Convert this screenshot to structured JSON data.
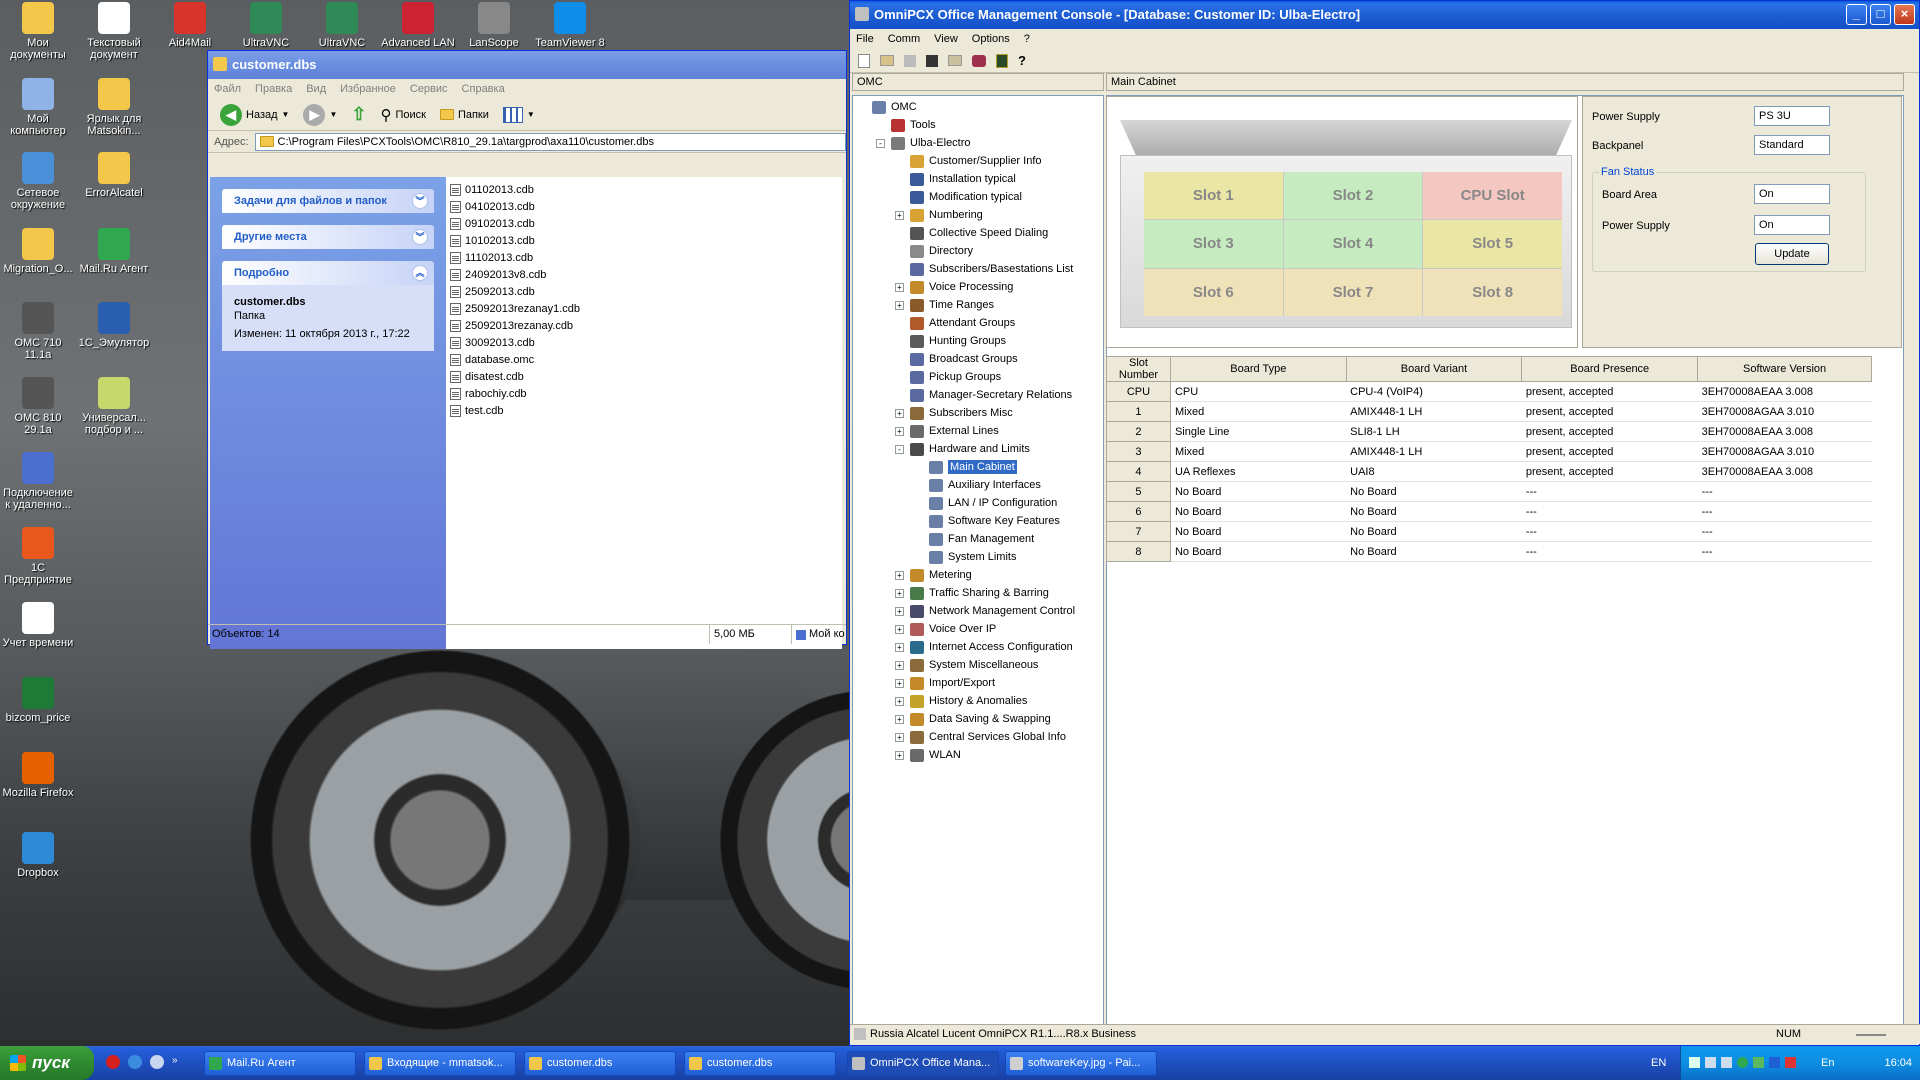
{
  "desktop": {
    "icons": [
      {
        "label": "Мои документы",
        "color": "#f3c74a"
      },
      {
        "label": "Текстовый документ",
        "color": "#ffffff"
      },
      {
        "label": "Aid4Mail",
        "color": "#d9342b"
      },
      {
        "label": "UltraVNC",
        "color": "#2e8b57"
      },
      {
        "label": "UltraVNC",
        "color": "#2e8b57"
      },
      {
        "label": "Advanced LAN",
        "color": "#cc2233"
      },
      {
        "label": "LanScope",
        "color": "#888888"
      },
      {
        "label": "TeamViewer 8",
        "color": "#0e8ee9"
      },
      {
        "label": "Мой компьютер",
        "color": "#8fb3e6"
      },
      {
        "label": "Ярлык для Matsokin...",
        "color": "#f3c74a"
      },
      {
        "label": "Сетевое окружение",
        "color": "#4a90d9"
      },
      {
        "label": "ErrorAlcatel",
        "color": "#f3c74a"
      },
      {
        "label": "Migration_O...",
        "color": "#f3c74a"
      },
      {
        "label": "Mail.Ru Агент",
        "color": "#2fa84f"
      },
      {
        "label": "OMC 710 11.1a",
        "color": "#555555"
      },
      {
        "label": "1C_Эмулятор",
        "color": "#2a5fb0"
      },
      {
        "label": "OMC 810 29.1a",
        "color": "#555555"
      },
      {
        "label": "Универсал... подбор и ...",
        "color": "#c6d86b"
      },
      {
        "label": "Подключение к удаленно...",
        "color": "#4a6fd1"
      },
      {
        "label": "1С Предприятие",
        "color": "#e8581c"
      },
      {
        "label": "Учет времени",
        "color": "#ffffff"
      },
      {
        "label": "bizcom_price",
        "color": "#1d7a37"
      },
      {
        "label": "Mozilla Firefox",
        "color": "#e66000"
      },
      {
        "label": "Dropbox",
        "color": "#2c8ad6"
      }
    ]
  },
  "explorer": {
    "title": "customer.dbs",
    "menu": [
      "Файл",
      "Правка",
      "Вид",
      "Избранное",
      "Сервис",
      "Справка"
    ],
    "toolbar": {
      "back": "Назад",
      "search": "Поиск",
      "folders": "Папки"
    },
    "address_label": "Адрес:",
    "address": "C:\\Program Files\\PCXTools\\OMC\\R810_29.1a\\targprod\\axa110\\customer.dbs",
    "tasks_label": "Задачи для файлов и папок",
    "places_label": "Другие места",
    "details_label": "Подробно",
    "details": {
      "name": "customer.dbs",
      "type": "Папка",
      "modified": "Изменен: 11 октября 2013 г., 17:22"
    },
    "files": [
      "01102013.cdb",
      "04102013.cdb",
      "09102013.cdb",
      "10102013.cdb",
      "11102013.cdb",
      "24092013v8.cdb",
      "25092013.cdb",
      "25092013rezanay1.cdb",
      "25092013rezanay.cdb",
      "30092013.cdb",
      "database.omc",
      "disatest.cdb",
      "rabochiy.cdb",
      "test.cdb"
    ],
    "status": {
      "count": "Объектов: 14",
      "size": "5,00 МБ",
      "location": "Мой ко"
    }
  },
  "omc": {
    "title": "OmniPCX Office Management Console - [Database:      Customer ID:  Ulba-Electro]",
    "menu": [
      "File",
      "Comm",
      "View",
      "Options",
      "?"
    ],
    "tree_header": "OMC",
    "content_header": "Main Cabinet",
    "tree": [
      {
        "label": "OMC",
        "level": 0,
        "exp": "",
        "icon": "#6a7fa8"
      },
      {
        "label": "Tools",
        "level": 1,
        "exp": "",
        "icon": "#b83232"
      },
      {
        "label": "Ulba-Electro",
        "level": 1,
        "exp": "-",
        "icon": "#7a7a7a"
      },
      {
        "label": "Customer/Supplier Info",
        "level": 2,
        "exp": "",
        "icon": "#d8a234"
      },
      {
        "label": "Installation typical",
        "level": 2,
        "exp": "",
        "icon": "#3a5a9a"
      },
      {
        "label": "Modification typical",
        "level": 2,
        "exp": "",
        "icon": "#3a5a9a"
      },
      {
        "label": "Numbering",
        "level": 2,
        "exp": "+",
        "icon": "#d8a234"
      },
      {
        "label": "Collective Speed Dialing",
        "level": 2,
        "exp": "",
        "icon": "#555555"
      },
      {
        "label": "Directory",
        "level": 2,
        "exp": "",
        "icon": "#8a8a8a"
      },
      {
        "label": "Subscribers/Basestations List",
        "level": 2,
        "exp": "",
        "icon": "#5a6aa0"
      },
      {
        "label": "Voice Processing",
        "level": 2,
        "exp": "+",
        "icon": "#c48a2a"
      },
      {
        "label": "Time Ranges",
        "level": 2,
        "exp": "+",
        "icon": "#8a5a2a"
      },
      {
        "label": "Attendant Groups",
        "level": 2,
        "exp": "",
        "icon": "#b05a2a"
      },
      {
        "label": "Hunting Groups",
        "level": 2,
        "exp": "",
        "icon": "#5a5a5a"
      },
      {
        "label": "Broadcast Groups",
        "level": 2,
        "exp": "",
        "icon": "#5a6aa0"
      },
      {
        "label": "Pickup Groups",
        "level": 2,
        "exp": "",
        "icon": "#5a6aa0"
      },
      {
        "label": "Manager-Secretary Relations",
        "level": 2,
        "exp": "",
        "icon": "#5a6aa0"
      },
      {
        "label": "Subscribers Misc",
        "level": 2,
        "exp": "+",
        "icon": "#8a6a3a"
      },
      {
        "label": "External Lines",
        "level": 2,
        "exp": "+",
        "icon": "#6a6a6a"
      },
      {
        "label": "Hardware and Limits",
        "level": 2,
        "exp": "-",
        "icon": "#4a4a4a"
      },
      {
        "label": "Main Cabinet",
        "level": 3,
        "exp": "",
        "icon": "#6a7fa8",
        "selected": true
      },
      {
        "label": "Auxiliary Interfaces",
        "level": 3,
        "exp": "",
        "icon": "#6a7fa8"
      },
      {
        "label": "LAN / IP Configuration",
        "level": 3,
        "exp": "",
        "icon": "#6a7fa8"
      },
      {
        "label": "Software Key Features",
        "level": 3,
        "exp": "",
        "icon": "#6a7fa8"
      },
      {
        "label": "Fan Management",
        "level": 3,
        "exp": "",
        "icon": "#6a7fa8"
      },
      {
        "label": "System Limits",
        "level": 3,
        "exp": "",
        "icon": "#6a7fa8"
      },
      {
        "label": "Metering",
        "level": 2,
        "exp": "+",
        "icon": "#c48a2a"
      },
      {
        "label": "Traffic Sharing & Barring",
        "level": 2,
        "exp": "+",
        "icon": "#4a7a4a"
      },
      {
        "label": "Network Management Control",
        "level": 2,
        "exp": "+",
        "icon": "#4a4a6a"
      },
      {
        "label": "Voice Over IP",
        "level": 2,
        "exp": "+",
        "icon": "#b05a5a"
      },
      {
        "label": "Internet Access Configuration",
        "level": 2,
        "exp": "+",
        "icon": "#2a6a8a"
      },
      {
        "label": "System Miscellaneous",
        "level": 2,
        "exp": "+",
        "icon": "#8a6a3a"
      },
      {
        "label": "Import/Export",
        "level": 2,
        "exp": "+",
        "icon": "#c48a2a"
      },
      {
        "label": "History & Anomalies",
        "level": 2,
        "exp": "+",
        "icon": "#c4a22a"
      },
      {
        "label": "Data Saving & Swapping",
        "level": 2,
        "exp": "+",
        "icon": "#c48a2a"
      },
      {
        "label": "Central Services Global Info",
        "level": 2,
        "exp": "+",
        "icon": "#8a6a3a"
      },
      {
        "label": "WLAN",
        "level": 2,
        "exp": "+",
        "icon": "#6a6a6a"
      }
    ],
    "slots": [
      {
        "label": "Slot 1",
        "color": "#eae6a5"
      },
      {
        "label": "Slot 2",
        "color": "#c6ebc0"
      },
      {
        "label": "CPU Slot",
        "color": "#f4c7c0"
      },
      {
        "label": "Slot 3",
        "color": "#c6ebc0"
      },
      {
        "label": "Slot 4",
        "color": "#c6ebc0"
      },
      {
        "label": "Slot 5",
        "color": "#eae6a5"
      },
      {
        "label": "Slot 6",
        "color": "#f0e2b8"
      },
      {
        "label": "Slot 7",
        "color": "#f0e2b8"
      },
      {
        "label": "Slot 8",
        "color": "#f0e2b8"
      }
    ],
    "props": {
      "power_supply_label": "Power Supply",
      "power_supply_value": "PS 3U",
      "backpanel_label": "Backpanel",
      "backpanel_value": "Standard",
      "fan_status_label": "Fan Status",
      "board_area_label": "Board Area",
      "board_area_value": "On",
      "fan_power_label": "Power Supply",
      "fan_power_value": "On",
      "update_button": "Update"
    },
    "table": {
      "columns": [
        "Slot Number",
        "Board Type",
        "Board Variant",
        "Board Presence",
        "Software Version"
      ],
      "rows": [
        [
          "CPU",
          "CPU",
          "CPU-4 (VoIP4)",
          "present, accepted",
          "3EH70008AEAA 3.008"
        ],
        [
          "1",
          "Mixed",
          "AMIX448-1 LH",
          "present, accepted",
          "3EH70008AGAA 3.010"
        ],
        [
          "2",
          "Single Line",
          "SLI8-1 LH",
          "present, accepted",
          "3EH70008AEAA 3.008"
        ],
        [
          "3",
          "Mixed",
          "AMIX448-1 LH",
          "present, accepted",
          "3EH70008AGAA 3.010"
        ],
        [
          "4",
          "UA Reflexes",
          "UAI8",
          "present, accepted",
          "3EH70008AEAA 3.008"
        ],
        [
          "5",
          "No Board",
          "No Board",
          "---",
          "---"
        ],
        [
          "6",
          "No Board",
          "No Board",
          "---",
          "---"
        ],
        [
          "7",
          "No Board",
          "No Board",
          "---",
          "---"
        ],
        [
          "8",
          "No Board",
          "No Board",
          "---",
          "---"
        ]
      ]
    },
    "status": {
      "text": "Russia Alcatel Lucent OmniPCX R1.1....R8.x Business",
      "num": "NUM"
    }
  },
  "taskbar": {
    "start": "пуск",
    "items": [
      {
        "label": "Mail.Ru Агент",
        "color": "#2fa84f"
      },
      {
        "label": "Входящие - mmatsok...",
        "color": "#f3c74a"
      },
      {
        "label": "customer.dbs",
        "color": "#f3c74a"
      },
      {
        "label": "customer.dbs",
        "color": "#f3c74a"
      },
      {
        "label": "OmniPCX Office Mana...",
        "color": "#c0c0c0"
      },
      {
        "label": "softwareKey.jpg - Pai...",
        "color": "#d0d0d0"
      }
    ],
    "lang": "EN",
    "lang2": "En",
    "time": "16:04"
  }
}
